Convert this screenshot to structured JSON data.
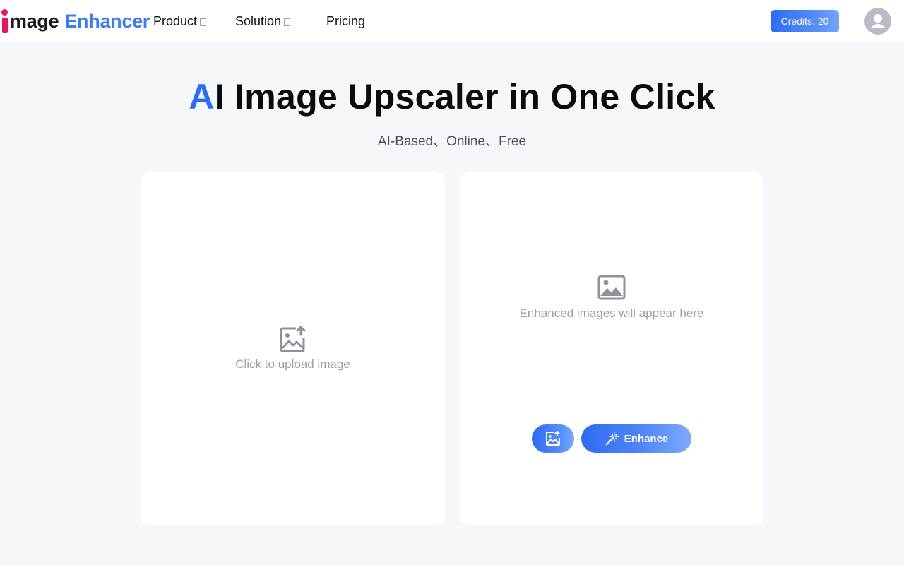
{
  "brand": {
    "word1": "mage",
    "word2": "Enhancer",
    "mark_color": "#e8175d",
    "accent_color": "#3d7bf0"
  },
  "nav": {
    "items": [
      {
        "label": "Product",
        "has_dropdown": true
      },
      {
        "label": "Solution",
        "has_dropdown": true
      },
      {
        "label": "Pricing",
        "has_dropdown": false
      }
    ]
  },
  "header": {
    "credits_label": "Credits: 20",
    "avatar_icon": "user-avatar-icon"
  },
  "hero": {
    "title_accent": "A",
    "title_rest": "I Image Upscaler in One Click",
    "subtitle": "AI-Based、Online、Free"
  },
  "upload_panel": {
    "icon": "image-upload-icon",
    "text": "Click to upload image"
  },
  "result_panel": {
    "icon": "image-icon",
    "text": "Enhanced images will appear here",
    "upload_button_icon": "image-upload-icon",
    "enhance_label": "Enhance",
    "enhance_icon": "magic-wand-icon"
  },
  "colors": {
    "primary": "#2f6bf2",
    "background": "#f5f7fb",
    "muted_text": "#9aa0a6"
  }
}
